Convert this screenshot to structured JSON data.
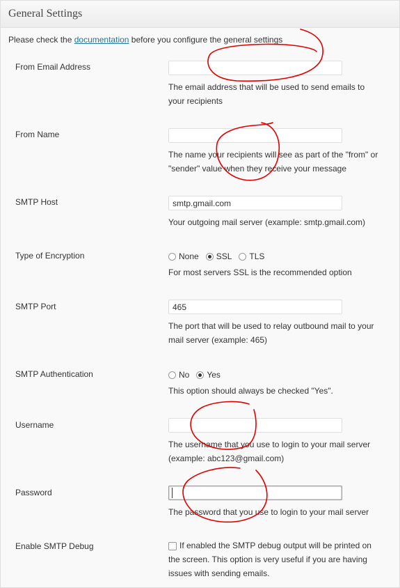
{
  "header": {
    "title": "General Settings"
  },
  "intro": {
    "before": "Please check the ",
    "link": "documentation",
    "after": " before you configure the general settings"
  },
  "fields": {
    "from_email": {
      "label": "From Email Address",
      "value": "",
      "desc1": "The email address that will be used to send emails to",
      "desc2": "your recipients"
    },
    "from_name": {
      "label": "From Name",
      "value": "",
      "desc1": "The name your recipients will see as part of the \"from\" or",
      "desc2": "\"sender\" value when they receive your message"
    },
    "smtp_host": {
      "label": "SMTP Host",
      "value": "smtp.gmail.com",
      "desc": "Your outgoing mail server (example: smtp.gmail.com)"
    },
    "encryption": {
      "label": "Type of Encryption",
      "options": [
        "None",
        "SSL",
        "TLS"
      ],
      "selected": "SSL",
      "desc": "For most servers SSL is the recommended option"
    },
    "smtp_port": {
      "label": "SMTP Port",
      "value": "465",
      "desc1": "The port that will be used to relay outbound mail to your",
      "desc2": "mail server (example: 465)"
    },
    "smtp_auth": {
      "label": "SMTP Authentication",
      "options": [
        "No",
        "Yes"
      ],
      "selected": "Yes",
      "desc": "This option should always be checked \"Yes\"."
    },
    "username": {
      "label": "Username",
      "value": "",
      "desc1": "The username that you use to login to your mail server",
      "desc2": "(example: abc123@gmail.com)"
    },
    "password": {
      "label": "Password",
      "value": "",
      "desc": "The password that you use to login to your mail server"
    },
    "debug": {
      "label": "Enable SMTP Debug",
      "checked": false,
      "desc1": "If enabled the SMTP debug output will be printed on",
      "desc2": "the screen. This option is very useful if you are having",
      "desc3": "issues with sending emails."
    }
  },
  "colors": {
    "link": "#21759b",
    "annotation": "#e00000"
  }
}
